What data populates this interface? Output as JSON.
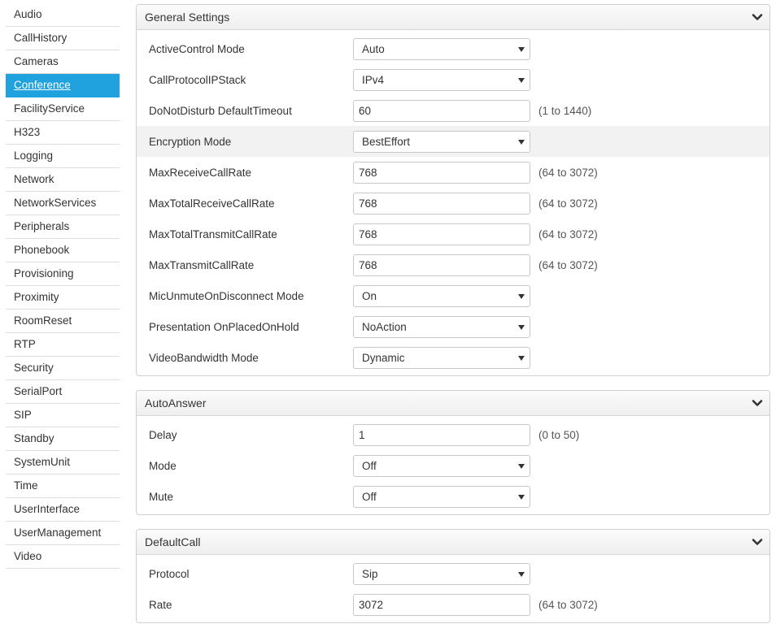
{
  "sidebar": {
    "items": [
      {
        "label": "Audio"
      },
      {
        "label": "CallHistory"
      },
      {
        "label": "Cameras"
      },
      {
        "label": "Conference",
        "active": true
      },
      {
        "label": "FacilityService"
      },
      {
        "label": "H323"
      },
      {
        "label": "Logging"
      },
      {
        "label": "Network"
      },
      {
        "label": "NetworkServices"
      },
      {
        "label": "Peripherals"
      },
      {
        "label": "Phonebook"
      },
      {
        "label": "Provisioning"
      },
      {
        "label": "Proximity"
      },
      {
        "label": "RoomReset"
      },
      {
        "label": "RTP"
      },
      {
        "label": "Security"
      },
      {
        "label": "SerialPort"
      },
      {
        "label": "SIP"
      },
      {
        "label": "Standby"
      },
      {
        "label": "SystemUnit"
      },
      {
        "label": "Time"
      },
      {
        "label": "UserInterface"
      },
      {
        "label": "UserManagement"
      },
      {
        "label": "Video"
      }
    ]
  },
  "panels": {
    "general": {
      "title": "General Settings",
      "rows": [
        {
          "label": "ActiveControl Mode",
          "type": "select",
          "value": "Auto"
        },
        {
          "label": "CallProtocolIPStack",
          "type": "select",
          "value": "IPv4"
        },
        {
          "label": "DoNotDisturb DefaultTimeout",
          "type": "input",
          "value": "60",
          "range": "(1 to 1440)"
        },
        {
          "label": "Encryption Mode",
          "type": "select",
          "value": "BestEffort"
        },
        {
          "label": "MaxReceiveCallRate",
          "type": "input",
          "value": "768",
          "range": "(64 to 3072)"
        },
        {
          "label": "MaxTotalReceiveCallRate",
          "type": "input",
          "value": "768",
          "range": "(64 to 3072)"
        },
        {
          "label": "MaxTotalTransmitCallRate",
          "type": "input",
          "value": "768",
          "range": "(64 to 3072)"
        },
        {
          "label": "MaxTransmitCallRate",
          "type": "input",
          "value": "768",
          "range": "(64 to 3072)"
        },
        {
          "label": "MicUnmuteOnDisconnect Mode",
          "type": "select",
          "value": "On"
        },
        {
          "label": "Presentation OnPlacedOnHold",
          "type": "select",
          "value": "NoAction"
        },
        {
          "label": "VideoBandwidth Mode",
          "type": "select",
          "value": "Dynamic"
        }
      ]
    },
    "autoanswer": {
      "title": "AutoAnswer",
      "rows": [
        {
          "label": "Delay",
          "type": "input",
          "value": "1",
          "range": "(0 to 50)"
        },
        {
          "label": "Mode",
          "type": "select",
          "value": "Off"
        },
        {
          "label": "Mute",
          "type": "select",
          "value": "Off"
        }
      ]
    },
    "defaultcall": {
      "title": "DefaultCall",
      "rows": [
        {
          "label": "Protocol",
          "type": "select",
          "value": "Sip"
        },
        {
          "label": "Rate",
          "type": "input",
          "value": "3072",
          "range": "(64 to 3072)"
        }
      ]
    }
  },
  "icons": {
    "collapse": "chevron-down-icon",
    "dropdown": "caret-down-icon"
  },
  "colors": {
    "accent": "#1fa2de",
    "row_highlight": "#f2f2f2"
  }
}
